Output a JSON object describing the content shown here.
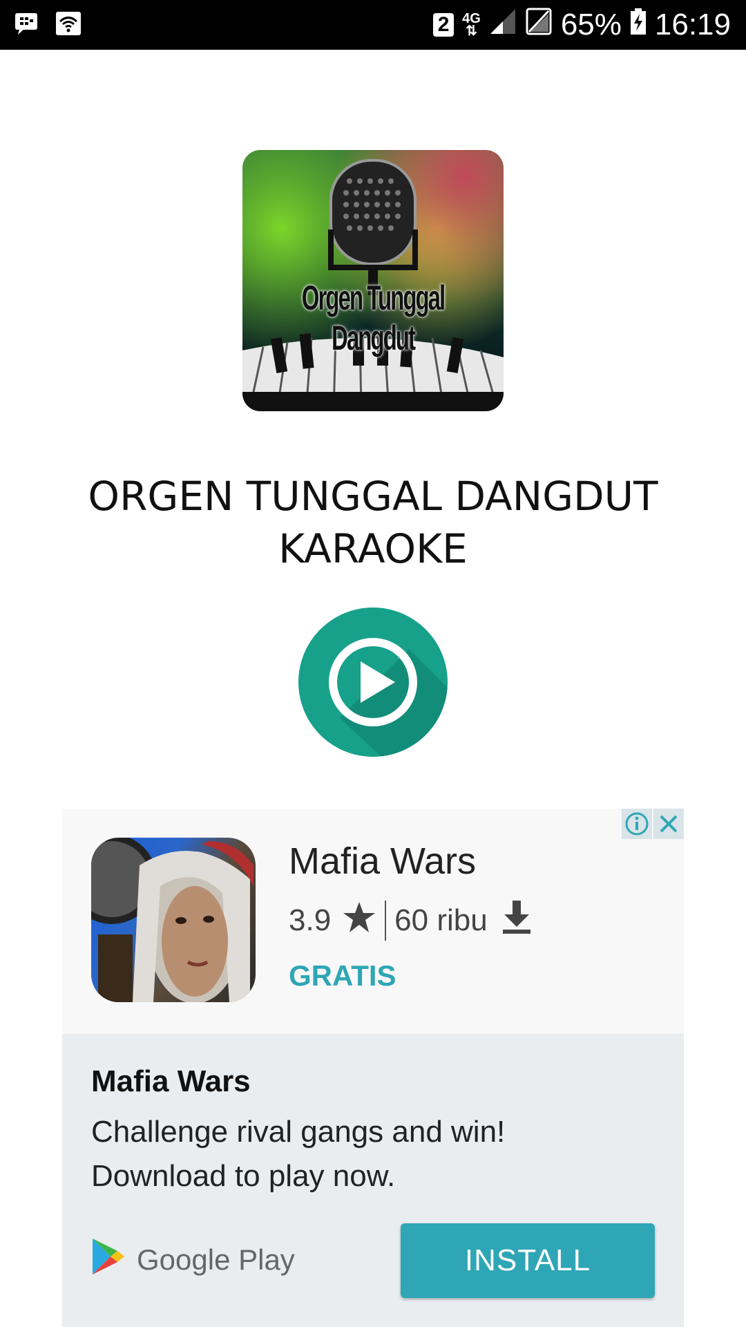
{
  "status_bar": {
    "sim_slot": "2",
    "network_type": "4G",
    "battery_percent": "65%",
    "time": "16:19",
    "icons": [
      "bbm-icon",
      "wifi-icon",
      "signal-icon",
      "no-sim-icon",
      "battery-charging-icon"
    ]
  },
  "app": {
    "icon_text": "Orgen Tunggal Dangdut",
    "title": "ORGEN TUNGGAL DANGDUT KARAOKE",
    "play_icon": "play-icon",
    "accent_color": "#17a18b"
  },
  "ad": {
    "app_name": "Mafia Wars",
    "rating": "3.9",
    "downloads": "60 ribu",
    "price": "GRATIS",
    "headline": "Mafia Wars",
    "body_line1": "Challenge rival gangs and win!",
    "body_line2": "Download to play now.",
    "store_label": "Google Play",
    "install_label": "INSTALL",
    "accent_color": "#2ea6b6"
  }
}
